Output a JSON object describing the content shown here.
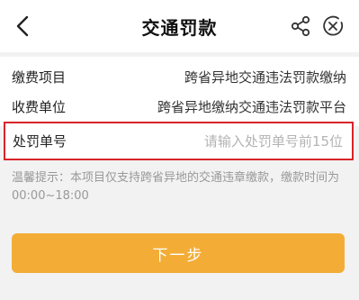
{
  "header": {
    "title": "交通罚款",
    "back_icon": "chevron-left-icon",
    "share_icon": "share-icon",
    "close_icon": "close-circle-icon"
  },
  "form": {
    "fee_item": {
      "label": "缴费项目",
      "value": "跨省异地交通违法罚款缴纳"
    },
    "payee": {
      "label": "收费单位",
      "value": "跨省异地缴纳交通违法罚款平台"
    },
    "penalty_number": {
      "label": "处罚单号",
      "placeholder": "请输入处罚单号前15位",
      "value": ""
    }
  },
  "hint": "温馨提示：本项目仅支持跨省异地的交通违章缴款，缴款时间为00:00~18:00",
  "next_button": "下一步",
  "colors": {
    "accent": "#f3ad36",
    "highlight_border": "#d9242b",
    "hint_text": "#999999"
  }
}
